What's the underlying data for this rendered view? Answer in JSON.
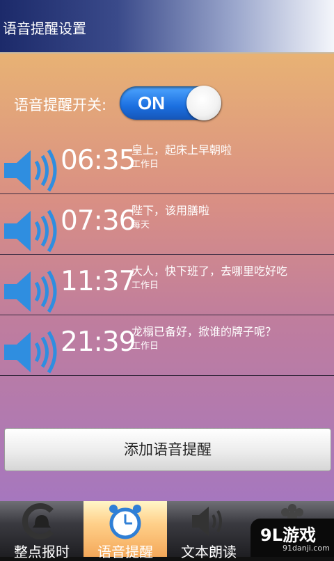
{
  "header": {
    "title": "语音提醒设置"
  },
  "switch": {
    "label": "语音提醒开关:",
    "state": "ON"
  },
  "reminders": [
    {
      "time": "06:35",
      "text": "皇上，起床上早朝啦",
      "repeat": "工作日"
    },
    {
      "time": "07:36",
      "text": "陛下，该用膳啦",
      "repeat": "每天"
    },
    {
      "time": "11:37",
      "text": "大人，快下班了，去哪里吃好吃",
      "repeat": "工作日"
    },
    {
      "time": "21:39",
      "text": "龙榻已备好，掀谁的牌子呢？",
      "repeat": "工作日"
    }
  ],
  "add_button": {
    "label": "添加语音提醒"
  },
  "tabs": [
    {
      "label": "整点报时",
      "icon": "bell-clock-icon",
      "active": false
    },
    {
      "label": "语音提醒",
      "icon": "alarm-clock-icon",
      "active": true
    },
    {
      "label": "文本朗读",
      "icon": "speaker-icon",
      "active": false
    },
    {
      "label": "",
      "icon": "settings-flower-icon",
      "active": false
    }
  ],
  "watermark": {
    "main": "9L游戏",
    "sub": "91danji.com"
  },
  "colors": {
    "accent": "#1b6fe0",
    "speaker": "#2f8ee0"
  }
}
